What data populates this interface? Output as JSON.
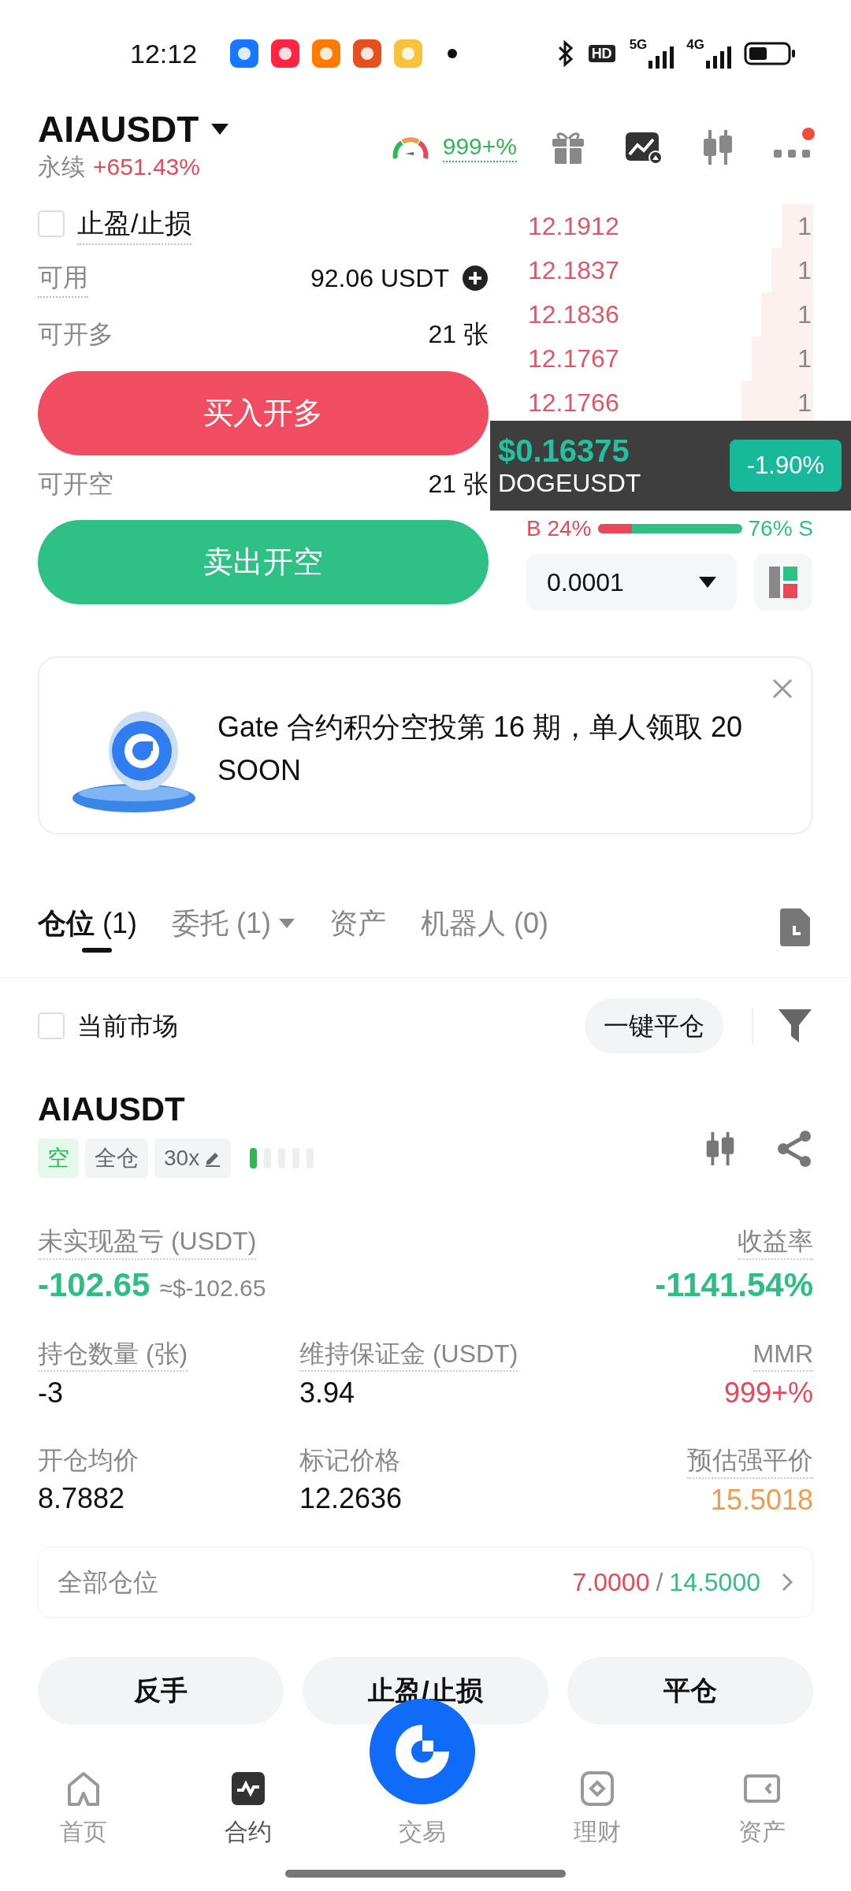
{
  "status_bar": {
    "time": "12:12",
    "hd": "HD",
    "network_1": "5G",
    "network_2": "4G"
  },
  "header": {
    "symbol": "AIAUSDT",
    "contract_type": "永续",
    "change": "+651.43%",
    "gauge_value": "999+%",
    "menu_badge": true
  },
  "trade_panel": {
    "tp_sl": {
      "label": "止盈/止损",
      "checked": false
    },
    "available": {
      "label": "可用",
      "value": "92.06 USDT"
    },
    "long_capacity": {
      "label": "可开多",
      "value": "21 张"
    },
    "buy_button": "买入开多",
    "short_capacity": {
      "label": "可开空",
      "value": "21 张"
    },
    "sell_button": "卖出开空"
  },
  "order_book": {
    "asks": [
      {
        "price": "12.1912",
        "amount": "1"
      },
      {
        "price": "12.1837",
        "amount": "1"
      },
      {
        "price": "12.1836",
        "amount": "1"
      },
      {
        "price": "12.1767",
        "amount": "1"
      },
      {
        "price": "12.1766",
        "amount": "1"
      }
    ],
    "ratio": {
      "buy": "B 24%",
      "sell": "76% S",
      "level": 0.24
    },
    "precision": "0.0001"
  },
  "ticker_overlay": {
    "price": "$0.16375",
    "symbol": "DOGEUSDT",
    "change": "-1.90%"
  },
  "banner": {
    "text": "Gate 合约积分空投第 16 期，单人领取 20 SOON"
  },
  "tabs": [
    {
      "label": "仓位",
      "count": "(1)",
      "selected": true,
      "dropdown": false
    },
    {
      "label": "委托",
      "count": "(1)",
      "selected": false,
      "dropdown": true
    },
    {
      "label": "资产",
      "selected": false,
      "dropdown": false
    },
    {
      "label": "机器人",
      "count": "(0)",
      "selected": false,
      "dropdown": false
    }
  ],
  "filter_row": {
    "current_market": {
      "label": "当前市场",
      "checked": false
    },
    "close_all_button": "一键平仓"
  },
  "position": {
    "symbol": "AIAUSDT",
    "tags": [
      {
        "text": "空",
        "kind": "side"
      },
      {
        "text": "全仓",
        "kind": "margin_mode"
      },
      {
        "text": "30x",
        "kind": "leverage"
      }
    ],
    "risk": {
      "level": 0.2
    },
    "metric_rows": [
      {
        "items": [
          {
            "label": "未实现盈亏 (USDT)",
            "value": "-102.65",
            "sub": "≈$-102.65",
            "color": "#2dbd85",
            "underlined": true
          },
          {
            "label": "收益率",
            "value": "-1141.54%",
            "color": "#2dbd85",
            "underlined": true
          }
        ]
      },
      {
        "items": [
          {
            "label": "持仓数量 (张)",
            "value": "-3",
            "color": "#111111",
            "underlined": true
          },
          {
            "label": "维持保证金 (USDT)",
            "value": "3.94",
            "color": "#111111",
            "underlined": true
          },
          {
            "label": "MMR",
            "value": "999+%",
            "color": "#e9485b",
            "underlined": true
          }
        ]
      },
      {
        "items": [
          {
            "label": "开仓均价",
            "value": "8.7882",
            "color": "#111111",
            "underlined": false
          },
          {
            "label": "标记价格",
            "value": "12.2636",
            "color": "#111111",
            "underlined": false
          },
          {
            "label": "预估强平价",
            "value": "15.5018",
            "color": "#f39a4c",
            "underlined": true
          }
        ]
      }
    ]
  },
  "all_positions": {
    "label": "全部仓位",
    "long": "7.0000",
    "separator": "/",
    "short": "14.5000"
  },
  "actions": [
    "反手",
    "止盈/止损",
    "平仓"
  ],
  "bottom_nav": [
    {
      "label": "首页",
      "kind": "home",
      "selected": false
    },
    {
      "label": "合约",
      "kind": "contract",
      "selected": true
    },
    {
      "label": "交易",
      "kind": "trade",
      "selected": false
    },
    {
      "label": "理财",
      "kind": "finance",
      "selected": false
    },
    {
      "label": "资产",
      "kind": "assets",
      "selected": false
    }
  ]
}
